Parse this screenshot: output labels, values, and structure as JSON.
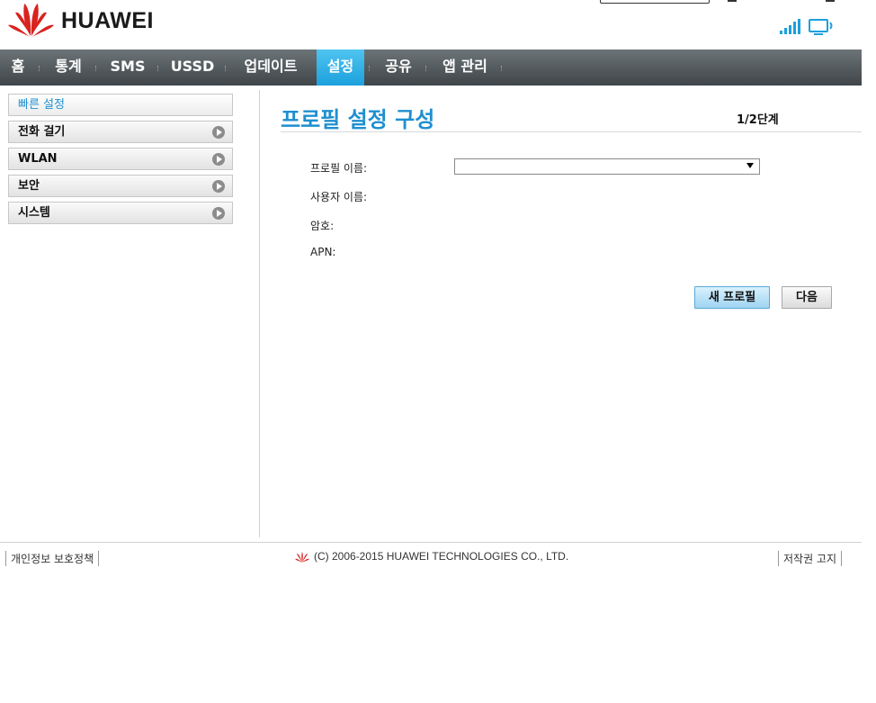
{
  "header": {
    "brand": "HUAWEI"
  },
  "nav": {
    "items": [
      {
        "label": "홈"
      },
      {
        "label": "통계"
      },
      {
        "label": "SMS"
      },
      {
        "label": "USSD"
      },
      {
        "label": "업데이트"
      },
      {
        "label": "설정",
        "active": true
      },
      {
        "label": "공유"
      },
      {
        "label": "앱 관리"
      }
    ]
  },
  "sidebar": {
    "items": [
      {
        "label": "빠른 설정",
        "selected": true
      },
      {
        "label": "전화 걸기"
      },
      {
        "label": "WLAN"
      },
      {
        "label": "보안"
      },
      {
        "label": "시스템"
      }
    ]
  },
  "main": {
    "title": "프로필 설정 구성",
    "step": "1/2단계",
    "fields": {
      "profile_name_label": "프로필 이름:",
      "username_label": "사용자 이름:",
      "password_label": "암호:",
      "apn_label": "APN:",
      "profile_select_value": ""
    },
    "buttons": {
      "new_profile": "새 프로필",
      "next": "다음"
    }
  },
  "footer": {
    "privacy": "개인정보 보호정책",
    "copyright": "(C) 2006-2015 HUAWEI TECHNOLOGIES CO., LTD.",
    "notice": "저작권 고지"
  },
  "colors": {
    "accent": "#1f8fd0",
    "nav_active": "#1ca0dc",
    "nav_bg": "#4a5155",
    "brand_red": "#d8231f"
  }
}
